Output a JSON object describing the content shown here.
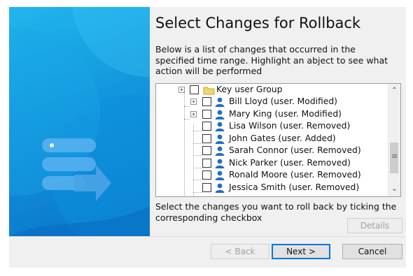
{
  "wizard": {
    "title": "Select Changes for Rollback",
    "description": "Below is a list of changes that occurred in the specified time range. Highlight an abject to see what action will be performed",
    "instruction": "Select the changes you want to roll back by ticking the corresponding checkbox"
  },
  "tree": {
    "group": {
      "label": "Key user Group",
      "icon": "folder-icon",
      "expander": "+"
    },
    "items": [
      {
        "label": "Bill Lloyd (user. Modified)",
        "icon": "user-icon",
        "expander": "+"
      },
      {
        "label": "Mary King (user. Modified)",
        "icon": "user-icon",
        "expander": "+"
      },
      {
        "label": "Lisa Wilson (user. Removed)",
        "icon": "user-icon"
      },
      {
        "label": "John Gates (user. Added)",
        "icon": "user-icon"
      },
      {
        "label": "Sarah Connor (user. Removed)",
        "icon": "user-icon"
      },
      {
        "label": "Nick Parker (user. Removed)",
        "icon": "user-icon"
      },
      {
        "label": "Ronald Moore (user. Removed)",
        "icon": "user-icon"
      },
      {
        "label": "Jessica Smith (user. Removed)",
        "icon": "user-icon"
      }
    ]
  },
  "buttons": {
    "details": "Details",
    "back": "< Back",
    "next": "Next >",
    "cancel": "Cancel"
  },
  "colors": {
    "banner_start": "#21b6ee",
    "banner_end": "#0a73c9",
    "user_icon": "#1f6fc2",
    "folder_icon": "#f2d768",
    "default_button_border": "#0078d7"
  }
}
